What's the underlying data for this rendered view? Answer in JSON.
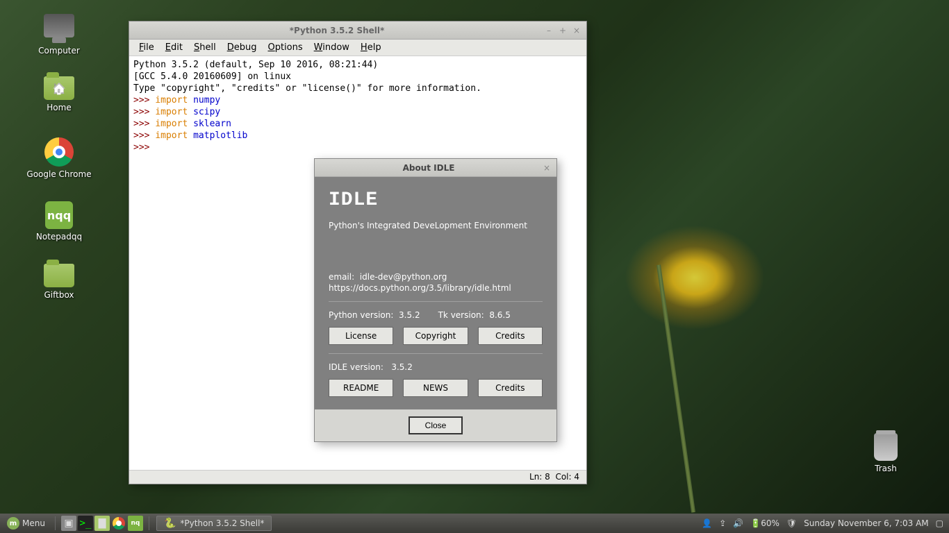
{
  "desktop": {
    "icons": [
      {
        "label": "Computer",
        "kind": "monitor"
      },
      {
        "label": "Home",
        "kind": "folder-home"
      },
      {
        "label": "Google Chrome",
        "kind": "chrome"
      },
      {
        "label": "Notepadqq",
        "kind": "nqq",
        "text": "nqq"
      },
      {
        "label": "Giftbox",
        "kind": "folder"
      }
    ],
    "trash": {
      "label": "Trash"
    }
  },
  "idle_window": {
    "title": "*Python 3.5.2 Shell*",
    "menu": [
      "File",
      "Edit",
      "Shell",
      "Debug",
      "Options",
      "Window",
      "Help"
    ],
    "shell": {
      "banner1": "Python 3.5.2 (default, Sep 10 2016, 08:21:44)",
      "banner2": "[GCC 5.4.0 20160609] on linux",
      "banner3": "Type \"copyright\", \"credits\" or \"license()\" for more information.",
      "prompt": ">>>",
      "kw": "import",
      "imports": [
        "numpy",
        "scipy",
        "sklearn",
        "matplotlib"
      ]
    },
    "status": {
      "ln": "Ln: 8",
      "col": "Col: 4"
    }
  },
  "about": {
    "title": "About IDLE",
    "heading": "IDLE",
    "subtitle": "Python's Integrated DeveLopment Environment",
    "email_label": "email:",
    "email": "idle-dev@python.org",
    "url": "https://docs.python.org/3.5/library/idle.html",
    "py_label": "Python version:",
    "py_ver": "3.5.2",
    "tk_label": "Tk version:",
    "tk_ver": "8.6.5",
    "btns1": [
      "License",
      "Copyright",
      "Credits"
    ],
    "idle_label": "IDLE version:",
    "idle_ver": "3.5.2",
    "btns2": [
      "README",
      "NEWS",
      "Credits"
    ],
    "close": "Close"
  },
  "taskbar": {
    "menu": "Menu",
    "task": "*Python 3.5.2 Shell*",
    "battery": "60%",
    "clock": "Sunday November  6,  7:03 AM"
  }
}
